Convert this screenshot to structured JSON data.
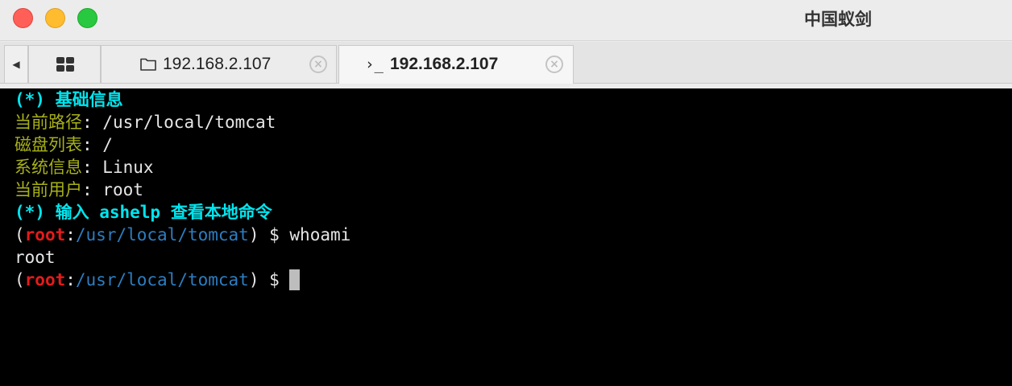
{
  "window": {
    "title": "中国蚁剑"
  },
  "tabs": [
    {
      "label": "192.168.2.107",
      "icon": "folder-icon",
      "active": false
    },
    {
      "label": "192.168.2.107",
      "icon": "terminal-prompt-icon",
      "active": true
    }
  ],
  "tab_glyphs": {
    "scroll_left": "◀",
    "close": "×",
    "prompt": "›_"
  },
  "terminal": {
    "basic_info_header": "(*) 基础信息",
    "info": [
      {
        "key": "当前路径",
        "sep": ": ",
        "value": "/usr/local/tomcat"
      },
      {
        "key": "磁盘列表",
        "sep": ": ",
        "value": "/"
      },
      {
        "key": "系统信息",
        "sep": ": ",
        "value": "Linux"
      },
      {
        "key": "当前用户",
        "sep": ": ",
        "value": "root"
      }
    ],
    "help_hint": "(*) 输入 ashelp 查看本地命令",
    "prompt": {
      "open": "(",
      "user": "root",
      "colon": ":",
      "path": "/usr/local/tomcat",
      "close": ") $ "
    },
    "command": "whoami",
    "output": "root"
  },
  "colors": {
    "header": "#00e5ee",
    "info_key": "#a7b01a",
    "prompt_user": "#e41b1b",
    "prompt_path": "#2d7dc0",
    "background": "#000000"
  }
}
